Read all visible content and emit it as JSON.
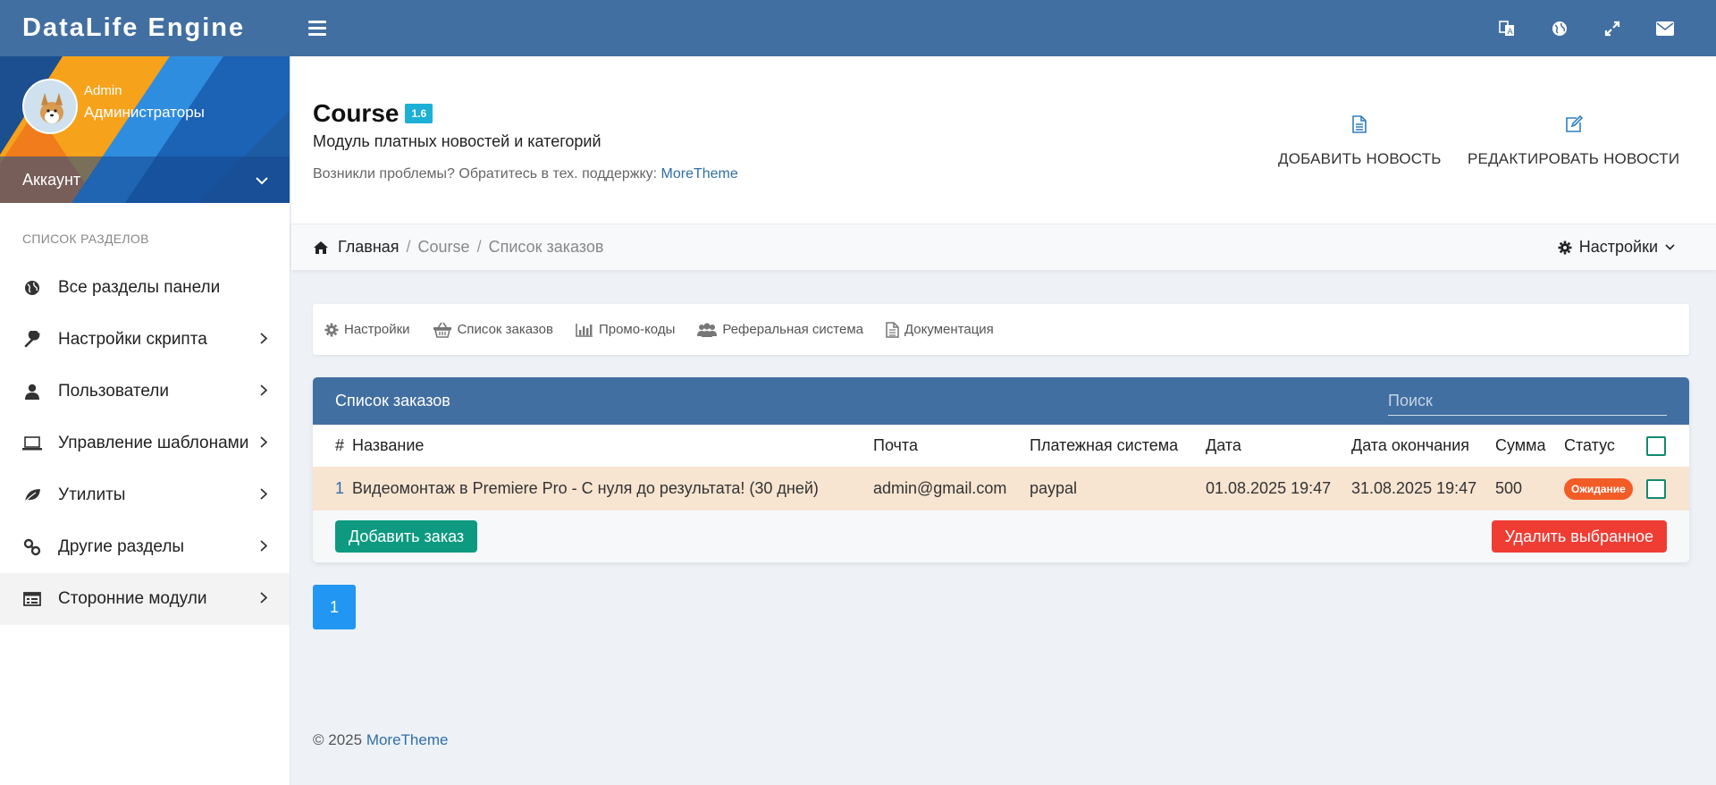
{
  "brand": "DataLife Engine",
  "topbar": {
    "icons": [
      "translate-icon",
      "globe-icon",
      "fullscreen-icon",
      "mail-icon"
    ]
  },
  "profile": {
    "name": "Admin",
    "group": "Администраторы",
    "account_label": "Аккаунт"
  },
  "sidebar": {
    "section_label": "Список разделов",
    "items": [
      {
        "label": "Все разделы панели",
        "icon": "globe-icon",
        "has_arrow": false
      },
      {
        "label": "Настройки скрипта",
        "icon": "wrench-icon",
        "has_arrow": true
      },
      {
        "label": "Пользователи",
        "icon": "user-icon",
        "has_arrow": true
      },
      {
        "label": "Управление шаблонами",
        "icon": "laptop-icon",
        "has_arrow": true
      },
      {
        "label": "Утилиты",
        "icon": "leaf-icon",
        "has_arrow": true
      },
      {
        "label": "Другие разделы",
        "icon": "link-icon",
        "has_arrow": true
      },
      {
        "label": "Сторонние модули",
        "icon": "list-icon",
        "has_arrow": true
      }
    ]
  },
  "header": {
    "title": "Course",
    "version": "1.6",
    "subtitle": "Модуль платных новостей и категорий",
    "support_text": "Возникли проблемы? Обратитесь в тех. поддержку:",
    "support_link": "MoreTheme",
    "actions": [
      {
        "label": "Добавить новость",
        "icon": "file-icon"
      },
      {
        "label": "Редактировать новости",
        "icon": "edit-icon"
      }
    ]
  },
  "breadcrumb": {
    "home": "Главная",
    "sep": "/",
    "module": "Course",
    "current": "Список заказов",
    "settings": "Настройки"
  },
  "tabs": [
    {
      "label": "Настройки",
      "icon": "gear-icon"
    },
    {
      "label": "Список заказов",
      "icon": "basket-icon"
    },
    {
      "label": "Промо-коды",
      "icon": "bar-chart-icon"
    },
    {
      "label": "Реферальная система",
      "icon": "users-icon"
    },
    {
      "label": "Документация",
      "icon": "document-icon"
    }
  ],
  "orders": {
    "title": "Список заказов",
    "search_placeholder": "Поиск",
    "columns": [
      "#",
      "Название",
      "Почта",
      "Платежная система",
      "Дата",
      "Дата окончания",
      "Сумма",
      "Статус"
    ],
    "rows": [
      {
        "id": "1",
        "name": "Видеомонтаж в Premiere Pro - С нуля до результата! (30 дней)",
        "email": "admin@gmail.com",
        "payment": "paypal",
        "date": "01.08.2025 19:47",
        "end_date": "31.08.2025 19:47",
        "sum": "500",
        "status": "Ожидание"
      }
    ],
    "add_button": "Добавить заказ",
    "delete_button": "Удалить выбранное"
  },
  "pagination": {
    "current": "1"
  },
  "footer": {
    "copyright": "© 2025",
    "link": "MoreTheme"
  },
  "colors": {
    "primary": "#426fa1",
    "accent_green": "#0e9a80",
    "danger": "#ef3d34",
    "status_waiting": "#f25c27",
    "row_highlight": "#f7e4d1",
    "page_blue": "#2196f3"
  }
}
